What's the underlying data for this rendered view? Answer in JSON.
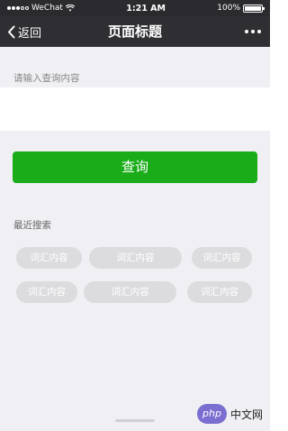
{
  "status_bar": {
    "carrier": "WeChat",
    "time": "1:21 AM",
    "battery": "100%",
    "battery_level": 1.0
  },
  "nav": {
    "back_label": "返回",
    "title": "页面标题"
  },
  "search": {
    "label": "请输入查询内容",
    "value": "",
    "placeholder": ""
  },
  "query_button": {
    "label": "查询"
  },
  "recent": {
    "title": "最近搜索",
    "tags": [
      "词汇内容",
      "词汇内容",
      "词汇内容",
      "词汇内容",
      "词汇内容",
      "词汇内容"
    ]
  },
  "watermark": {
    "badge": "php",
    "text": "中文网"
  },
  "colors": {
    "accent": "#1aad19",
    "navbar": "#2f2f33",
    "background": "#efeff4"
  }
}
